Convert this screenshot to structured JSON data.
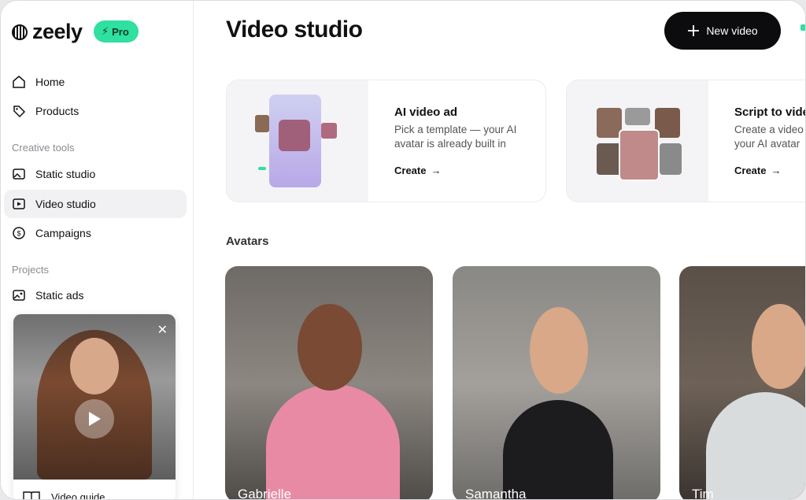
{
  "brand": {
    "name": "zeely",
    "badge": "Pro"
  },
  "sidebar": {
    "items": [
      {
        "label": "Home",
        "icon": "home-icon"
      },
      {
        "label": "Products",
        "icon": "tag-icon"
      },
      {
        "label": "Static studio",
        "icon": "image-icon"
      },
      {
        "label": "Video studio",
        "icon": "video-icon"
      },
      {
        "label": "Campaigns",
        "icon": "dollar-icon"
      },
      {
        "label": "Static ads",
        "icon": "gallery-icon"
      }
    ],
    "sections": {
      "creative_tools": "Creative tools",
      "projects": "Projects"
    },
    "guide": {
      "label": "Video guide"
    }
  },
  "header": {
    "title": "Video studio",
    "new_video_label": "New video"
  },
  "tools": [
    {
      "title": "AI video ad",
      "desc": "Pick a template — your AI avatar is already built in",
      "cta": "Create"
    },
    {
      "title": "Script to vide",
      "desc": "Create a video your AI avatar",
      "cta": "Create"
    }
  ],
  "avatars": {
    "title": "Avatars",
    "items": [
      {
        "name": "Gabrielle"
      },
      {
        "name": "Samantha"
      },
      {
        "name": "Tim"
      }
    ]
  },
  "colors": {
    "accent": "#2fe0a0",
    "button": "#0c0c0e"
  }
}
